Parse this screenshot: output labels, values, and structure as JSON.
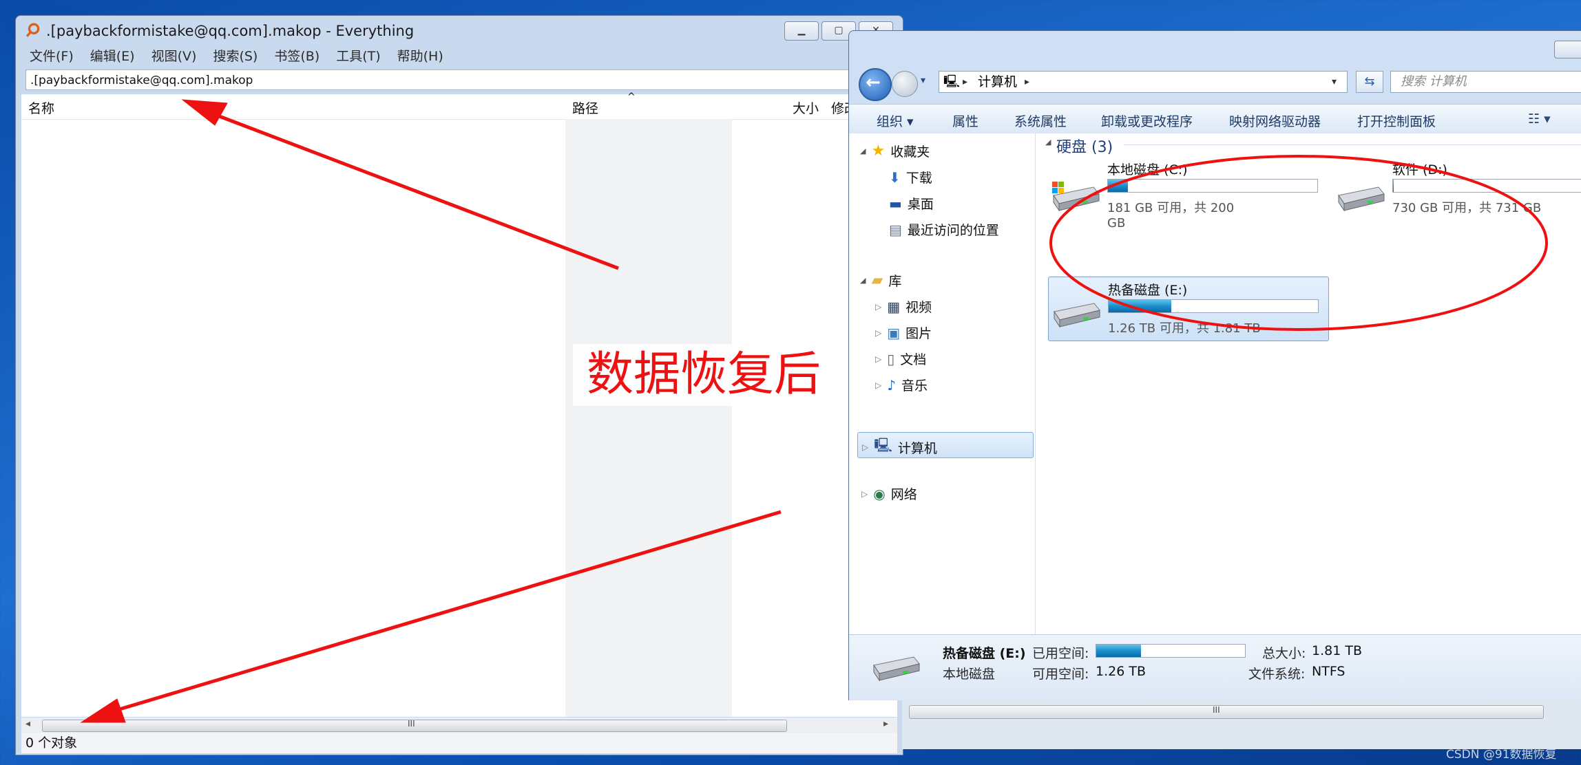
{
  "everything": {
    "title": ".[paybackformistake@qq.com].makop - Everything",
    "menu": [
      "文件(F)",
      "编辑(E)",
      "视图(V)",
      "搜索(S)",
      "书签(B)",
      "工具(T)",
      "帮助(H)"
    ],
    "search_value": ".[paybackformistake@qq.com].makop",
    "columns": {
      "name": "名称",
      "path": "路径",
      "size": "大小",
      "modified": "修改"
    },
    "hscroll_grip": "III",
    "status": "0 个对象"
  },
  "explorer": {
    "breadcrumb": "计算机",
    "search_placeholder": "搜索 计算机",
    "toolbar": [
      "组织 ▾",
      "属性",
      "系统属性",
      "卸载或更改程序",
      "映射网络驱动器",
      "打开控制面板"
    ],
    "nav": {
      "favorites": "收藏夹",
      "favorites_items": [
        "下载",
        "桌面",
        "最近访问的位置"
      ],
      "libraries": "库",
      "library_items": [
        "视频",
        "图片",
        "文档",
        "音乐"
      ],
      "computer": "计算机",
      "network": "网络"
    },
    "group_title": "硬盘 (3)",
    "drives": [
      {
        "name": "本地磁盘 (C:)",
        "size_text": "181 GB 可用，共 200 GB",
        "used_fraction": 0.095
      },
      {
        "name": "软件 (D:)",
        "size_text": "730 GB 可用，共 731 GB",
        "used_fraction": 0.0014
      },
      {
        "name": "热备磁盘 (E:)",
        "size_text": "1.26 TB 可用，共 1.81 TB",
        "used_fraction": 0.3
      }
    ],
    "details": {
      "drive_name": "热备磁盘 (E:)",
      "drive_type": "本地磁盘",
      "used_label": "已用空间:",
      "free_label": "可用空间:",
      "free_value": "1.26 TB",
      "total_label": "总大小:",
      "total_value": "1.81 TB",
      "fs_label": "文件系统:",
      "fs_value": "NTFS",
      "used_fraction": 0.3
    },
    "hscroll_grip": "III"
  },
  "annotation": {
    "text": "数据恢复后",
    "color": "#ee1111"
  },
  "watermark": "CSDN @91数据恢复"
}
